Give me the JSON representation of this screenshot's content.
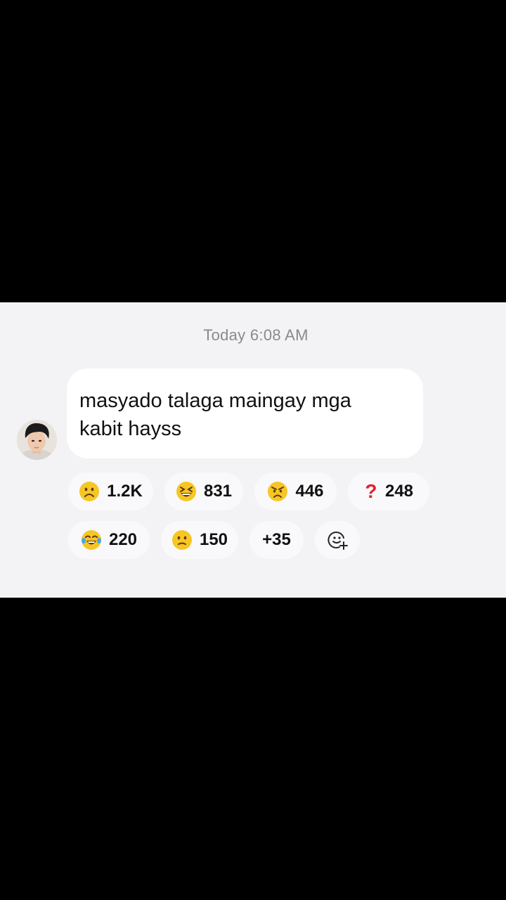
{
  "timestamp": "Today 6:08 AM",
  "message": {
    "text_line1": "masyado talaga maingay mga",
    "text_line2": "kabit hayss"
  },
  "reactions": [
    {
      "icon": "frowning-face-icon",
      "count": "1.2K"
    },
    {
      "icon": "squinting-grin-face-icon",
      "count": "831"
    },
    {
      "icon": "angry-face-icon",
      "count": "446"
    },
    {
      "icon": "red-question-mark-icon",
      "count": "248"
    },
    {
      "icon": "tears-of-joy-face-icon",
      "count": "220"
    },
    {
      "icon": "slightly-frowning-face-icon",
      "count": "150"
    }
  ],
  "more_reactions": "+35",
  "colors": {
    "chat_background": "#f3f3f5",
    "bubble": "#ffffff",
    "timestamp_text": "#8a8a8e",
    "emoji_yellow": "#f7c624",
    "question_red": "#e0232e"
  }
}
